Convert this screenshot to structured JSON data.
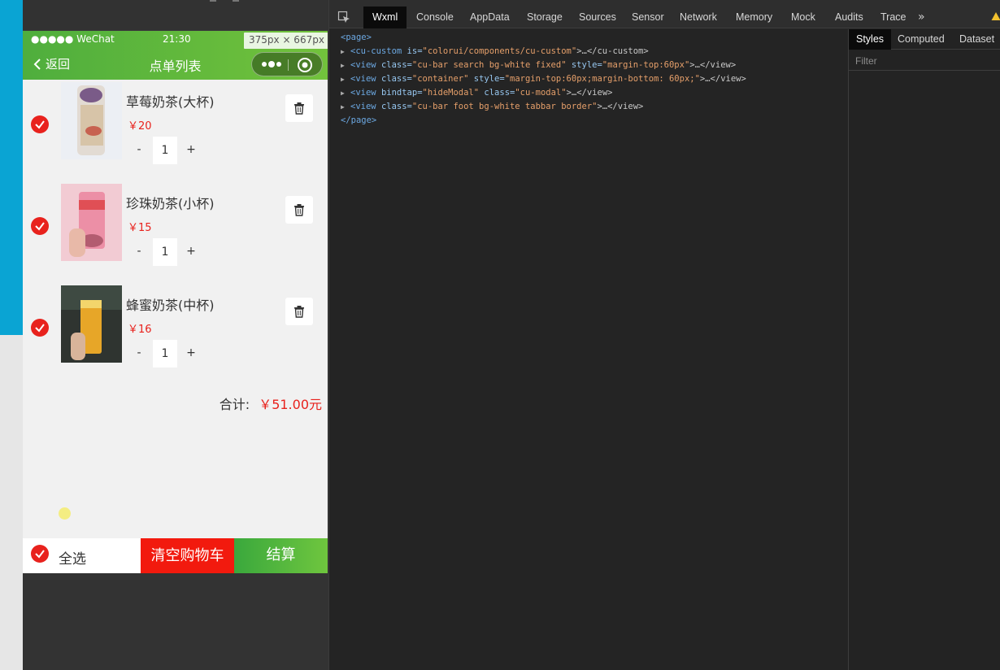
{
  "simulator": {
    "status_bar": {
      "carrier": "●●●●● WeChat",
      "time": "21:30"
    },
    "size_hint": "375px × 667px",
    "nav": {
      "back_label": "返回",
      "title": "点单列表"
    },
    "items": [
      {
        "name": "草莓奶茶(大杯)",
        "price": "￥20",
        "quantity": "1",
        "checked": true
      },
      {
        "name": "珍珠奶茶(小杯)",
        "price": "￥15",
        "quantity": "1",
        "checked": true
      },
      {
        "name": "蜂蜜奶茶(中杯)",
        "price": "￥16",
        "quantity": "1",
        "checked": true
      }
    ],
    "stepper": {
      "minus": "-",
      "plus": "+"
    },
    "total": {
      "label": "合计:",
      "amount": "￥51.00元"
    },
    "footer": {
      "select_all": "全选",
      "clear_cart": "清空购物车",
      "checkout": "结算"
    },
    "colors": {
      "brand_green": "#4fae3d",
      "accent_red": "#e8221d",
      "clear_red": "#f21a0e"
    }
  },
  "devtools": {
    "tabs": [
      "Wxml",
      "Console",
      "AppData",
      "Storage",
      "Sources",
      "Sensor",
      "Network",
      "Memory",
      "Mock",
      "Audits",
      "Trace"
    ],
    "active_tab": "Wxml",
    "xml": {
      "page_open": "<page>",
      "page_close": "</page>",
      "lines": [
        {
          "tag": "<cu-custom",
          "attrs": [
            {
              "name": "is",
              "value": "\"colorui/components/cu-custom\""
            }
          ],
          "tail": ">…</cu-custom>"
        },
        {
          "tag": "<view",
          "attrs": [
            {
              "name": "class",
              "value": "\"cu-bar search bg-white fixed\""
            },
            {
              "name": "style",
              "value": "\"margin-top:60px\""
            }
          ],
          "tail": ">…</view>"
        },
        {
          "tag": "<view",
          "attrs": [
            {
              "name": "class",
              "value": "\"container\""
            },
            {
              "name": "style",
              "value": "\"margin-top:60px;margin-bottom: 60px;\""
            }
          ],
          "tail": ">…</view>"
        },
        {
          "tag": "<view",
          "attrs": [
            {
              "name": "bindtap",
              "value": "\"hideModal\""
            },
            {
              "name": "class",
              "value": "\"cu-modal\""
            }
          ],
          "tail": ">…</view>"
        },
        {
          "tag": "<view",
          "attrs": [
            {
              "name": "class",
              "value": "\"cu-bar foot bg-white tabbar border\""
            }
          ],
          "tail": ">…</view>"
        }
      ]
    },
    "styles_tabs": [
      "Styles",
      "Computed",
      "Dataset"
    ],
    "styles_active": "Styles",
    "filter_placeholder": "Filter"
  }
}
